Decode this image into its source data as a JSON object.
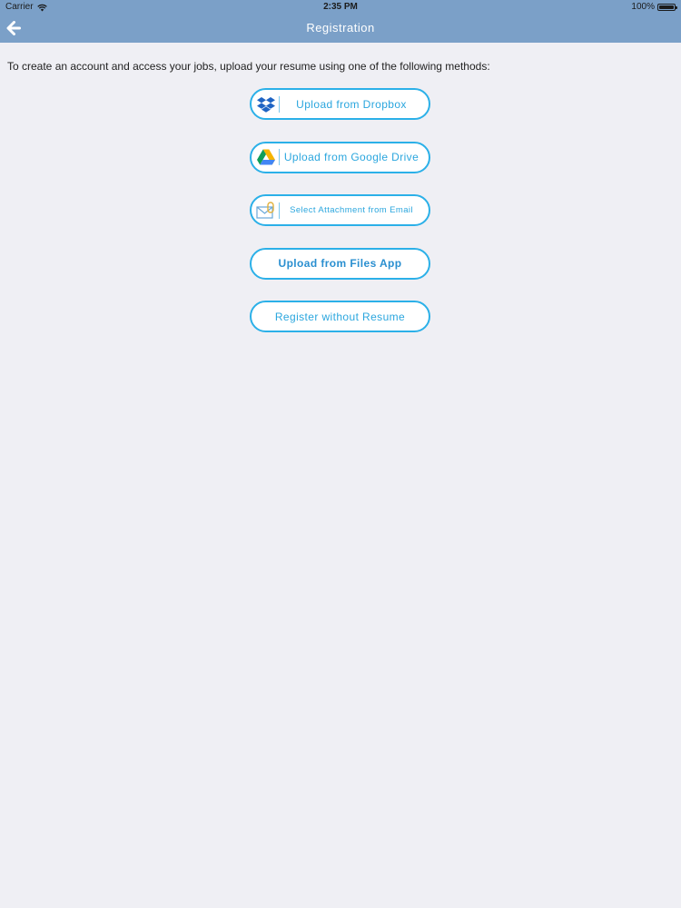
{
  "status_bar": {
    "carrier": "Carrier",
    "time": "2:35 PM",
    "battery": "100%"
  },
  "nav": {
    "title": "Registration",
    "back_icon": "arrow-left-icon"
  },
  "intro": "To create an account and access your jobs, upload your resume using one of the following methods:",
  "buttons": {
    "dropbox": "Upload from Dropbox",
    "google_drive": "Upload from Google Drive",
    "email": "Select Attachment from Email",
    "files_app": "Upload from Files App",
    "no_resume": "Register without Resume"
  },
  "colors": {
    "nav_background": "#7ba0c8",
    "button_border": "#2bb0e8",
    "button_text": "#2aa6de",
    "page_background": "#efeff4"
  }
}
